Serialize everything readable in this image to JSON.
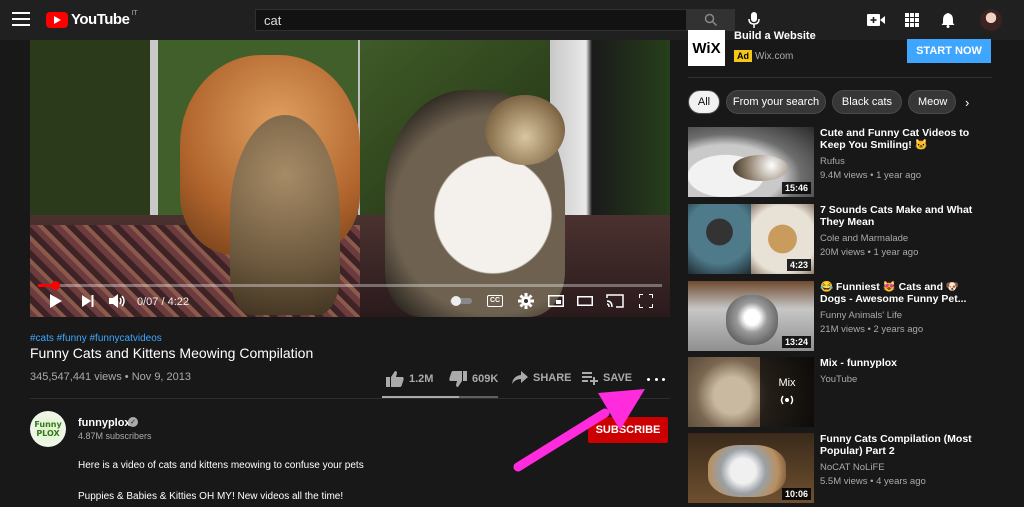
{
  "colors": {
    "brand_red": "#ff0000",
    "subscribe_red": "#cc0000",
    "link_blue": "#3ea6ff",
    "arrow_magenta": "#ff2bdc",
    "ad_badge_yellow": "#f5c518"
  },
  "header": {
    "logo_text": "YouTube",
    "country": "IT",
    "search_value": "cat",
    "icons": [
      "menu-icon",
      "search-icon",
      "microphone-icon",
      "create-video-icon",
      "apps-grid-icon",
      "notifications-bell-icon",
      "avatar"
    ]
  },
  "player": {
    "time": "0/07 / 4:22",
    "progress_fraction": 0.027,
    "controls": [
      "play-icon",
      "next-icon",
      "volume-icon",
      "autoplay-toggle",
      "captions-icon",
      "settings-gear-icon",
      "miniplayer-icon",
      "theater-mode-icon",
      "cast-icon",
      "fullscreen-icon"
    ],
    "captions_label": "CC"
  },
  "video": {
    "hashtags": "#cats #funny #funnycatvideos",
    "title": "Funny Cats and Kittens Meowing Compilation",
    "views_date": "345,547,441 views • Nov 9, 2013",
    "like_count": "1.2M",
    "dislike_count": "609K",
    "share_label": "SHARE",
    "save_label": "SAVE",
    "like_ratio": 0.66
  },
  "channel": {
    "name": "funnyplox",
    "subscribers": "4.87M subscribers",
    "avatar_text_1": "Funny",
    "avatar_text_2": "PLOX",
    "subscribe_label": "SUBSCRIBE",
    "description_line_1": "Here is a video of cats and kittens meowing to confuse your pets",
    "description_line_2": "Puppies & Babies & Kitties OH MY! New videos all the time!"
  },
  "ad": {
    "logo": "WiX",
    "title": "Build a Website",
    "badge": "Ad",
    "domain": "Wix.com",
    "cta": "START NOW"
  },
  "chips": [
    "All",
    "From your search",
    "Black cats",
    "Meow"
  ],
  "recommendations": [
    {
      "title": "Cute and Funny Cat Videos to Keep You Smiling! 🐱",
      "channel": "Rufus",
      "meta": "9.4M views • 1 year ago",
      "duration": "15:46"
    },
    {
      "title": "7 Sounds Cats Make and What They Mean",
      "channel": "Cole and Marmalade",
      "meta": "20M views • 1 year ago",
      "duration": "4:23"
    },
    {
      "title": "😂 Funniest 😻 Cats and 🐶 Dogs - Awesome Funny Pet...",
      "channel": "Funny Animals' Life",
      "meta": "21M views • 2 years ago",
      "duration": "13:24"
    },
    {
      "title": "Mix - funnyplox",
      "channel": "YouTube",
      "meta": "",
      "duration": "",
      "mix_label": "Mix"
    },
    {
      "title": "Funny Cats Compilation (Most Popular) Part 2",
      "channel": "NoCAT NoLiFE",
      "meta": "5.5M views • 4 years ago",
      "duration": "10:06"
    }
  ]
}
